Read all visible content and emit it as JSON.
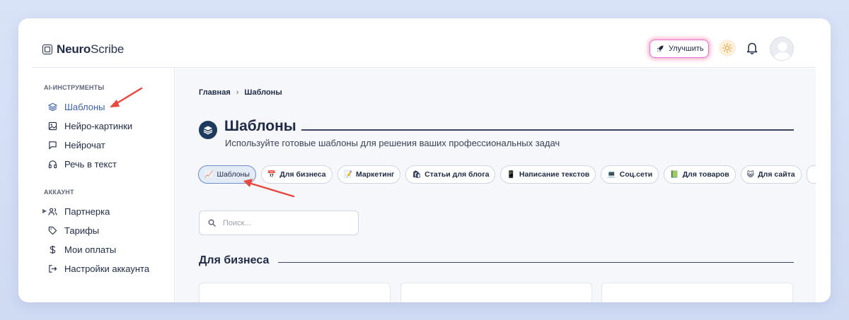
{
  "header": {
    "logo_bold": "Neuro",
    "logo_light": "Scribe",
    "upgrade_label": "Улучшить"
  },
  "sidebar": {
    "sections": [
      {
        "label": "AI-ИНСТРУМЕНТЫ",
        "items": [
          {
            "label": "Шаблоны",
            "icon": "layers-icon",
            "active": true
          },
          {
            "label": "Нейро-картинки",
            "icon": "image-icon"
          },
          {
            "label": "Нейрочат",
            "icon": "chat-icon"
          },
          {
            "label": "Речь в текст",
            "icon": "headphones-icon"
          }
        ]
      },
      {
        "label": "АККАУНТ",
        "items": [
          {
            "label": "Партнерка",
            "icon": "users-icon",
            "expandable": true
          },
          {
            "label": "Тарифы",
            "icon": "tag-icon"
          },
          {
            "label": "Мои оплаты",
            "icon": "dollar-icon"
          },
          {
            "label": "Настройки аккаунта",
            "icon": "logout-icon"
          }
        ]
      }
    ]
  },
  "breadcrumb": [
    "Главная",
    "Шаблоны"
  ],
  "page": {
    "title": "Шаблоны",
    "subtitle": "Используйте готовые шаблоны для решения ваших профессиональных задач"
  },
  "chips": [
    {
      "emoji": "📈",
      "label": "Шаблоны",
      "active": true
    },
    {
      "emoji": "📅",
      "label": "Для бизнеса"
    },
    {
      "emoji": "📝",
      "label": "Маркетинг"
    },
    {
      "emoji": "🛍",
      "label": "Статьи для блога"
    },
    {
      "emoji": "📱",
      "label": "Написание текстов"
    },
    {
      "emoji": "💻",
      "label": "Соц.сети"
    },
    {
      "emoji": "📗",
      "label": "Для товаров"
    },
    {
      "emoji": "😺",
      "label": "Для сайта"
    }
  ],
  "search": {
    "placeholder": "Поиск..."
  },
  "section_title": "Для бизнеса",
  "colors": {
    "accent": "#3b5fa8",
    "title_dark": "#1f3a5f",
    "arrow": "#e8473f"
  }
}
